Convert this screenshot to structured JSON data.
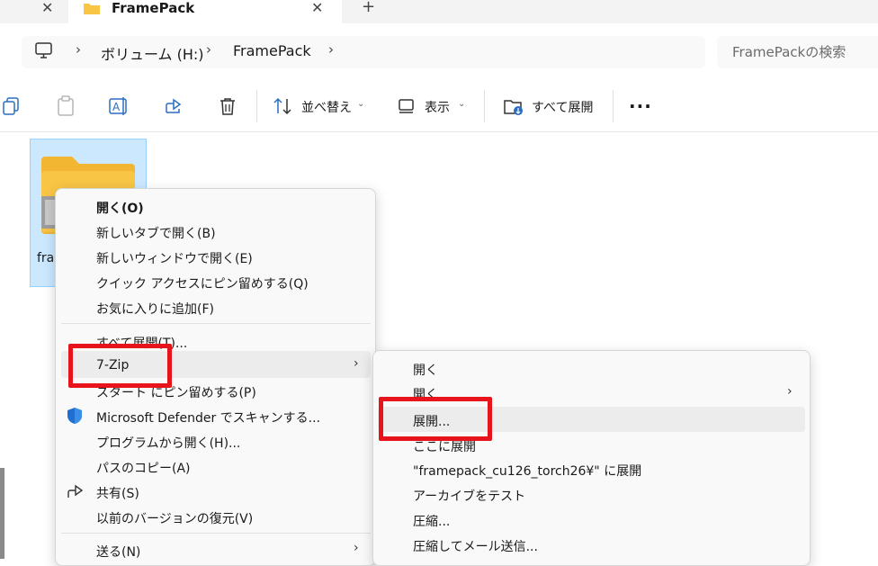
{
  "tabs": {
    "active_title": "FramePack"
  },
  "address": {
    "crumbs": [
      "ボリューム (H:)",
      "FramePack"
    ],
    "search_placeholder": "FramePackの検索"
  },
  "toolbar": {
    "sort_label": "並べ替え",
    "view_label": "表示",
    "extract_all_label": "すべて展開",
    "more_label": "..."
  },
  "folder": {
    "name_partial": "fram"
  },
  "context_menu": {
    "items": [
      "開く(O)",
      "新しいタブで開く(B)",
      "新しいウィンドウで開く(E)",
      "クイック アクセスにピン留めする(Q)",
      "お気に入りに追加(F)",
      "すべて展開(T)...",
      "7-Zip",
      "スタート にピン留めする(P)",
      "Microsoft Defender でスキャンする...",
      "プログラムから開く(H)...",
      "パスのコピー(A)",
      "共有(S)",
      "以前のバージョンの復元(V)",
      "送る(N)"
    ]
  },
  "submenu_7zip": {
    "items": [
      "開く",
      "開く",
      "展開...",
      "ここに展開",
      "\"framepack_cu126_torch26¥\" に展開",
      "アーカイブをテスト",
      "圧縮...",
      "圧縮してメール送信..."
    ]
  },
  "colors": {
    "highlight_red": "#e8141b",
    "selection_blue": "#cce8ff",
    "folder_yellow": "#f8c545"
  }
}
